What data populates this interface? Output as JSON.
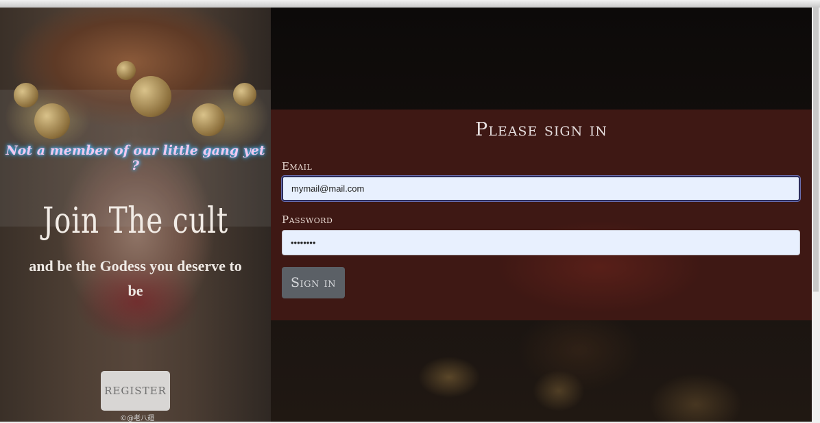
{
  "left_panel": {
    "tagline": "Not a member of our little gang yet ?",
    "title": "Join The cult",
    "subtitle": "and be the Godess you deserve to be",
    "register_label": "REGISTER",
    "credit": "©@老八翅"
  },
  "signin": {
    "title": "Please sign in",
    "email_label": "Email",
    "email_value": "mymail@mail.com",
    "password_label": "Password",
    "password_value": "12345678",
    "button_label": "Sign in"
  },
  "colors": {
    "panel_background": "#3e1814",
    "button_background": "#5b6066",
    "input_background": "#e8f0fe",
    "tagline_glow": "#55c8ff"
  }
}
